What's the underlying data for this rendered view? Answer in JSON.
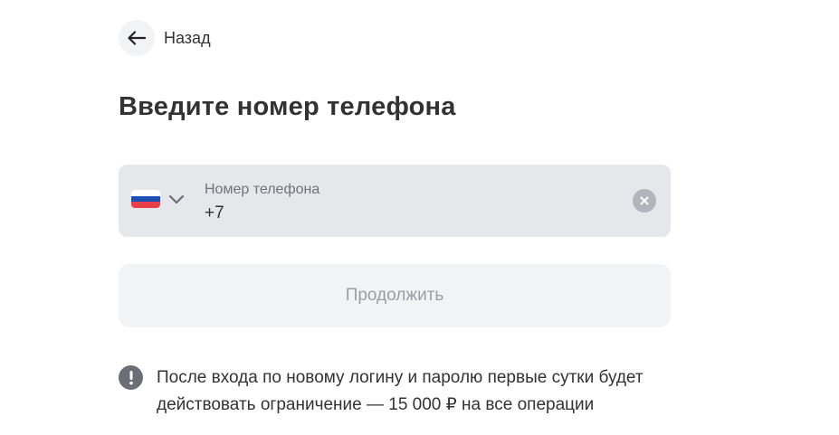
{
  "header": {
    "back_label": "Назад"
  },
  "main": {
    "title": "Введите номер телефона",
    "phone_field": {
      "label": "Номер телефона",
      "value": "+7",
      "country": "RU"
    },
    "continue_label": "Продолжить",
    "notice": {
      "line1": "После входа по новому логину и паролю первые сутки будет",
      "line2": "действовать ограничение — 15 000 ₽ на все операции"
    }
  },
  "colors": {
    "field_background": "#e6e7ea",
    "button_background": "#f2f3f5",
    "button_text_disabled": "#9a9ea4",
    "text_primary": "#333333"
  },
  "icons": [
    "arrow-left-icon",
    "flag-russia-icon",
    "chevron-down-icon",
    "clear-icon",
    "exclamation-icon"
  ]
}
